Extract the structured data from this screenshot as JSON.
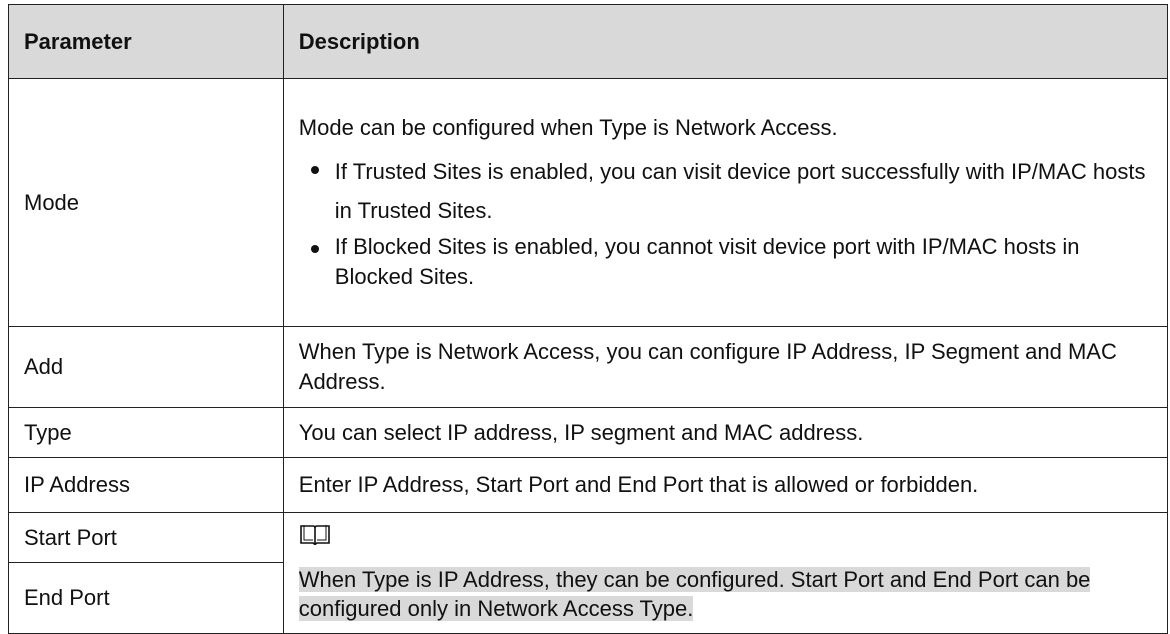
{
  "table": {
    "headers": {
      "parameter": "Parameter",
      "description": "Description"
    },
    "mode": {
      "name": "Mode",
      "intro": "Mode can be configured when Type is Network Access.",
      "bullets": [
        "If Trusted Sites is enabled, you can visit device port successfully with IP/MAC hosts in Trusted Sites.",
        "If Blocked Sites is enabled, you cannot visit device port with IP/MAC hosts in Blocked Sites."
      ]
    },
    "add": {
      "name": "Add",
      "description": "When Type is Network Access, you can configure IP Address, IP Segment and MAC Address."
    },
    "type": {
      "name": "Type",
      "description": "You can select IP address, IP segment and MAC address."
    },
    "ip_address": {
      "name": "IP Address",
      "description": "Enter IP Address, Start Port and End Port that is allowed or forbidden."
    },
    "start_port": {
      "name": "Start Port"
    },
    "end_port": {
      "name": "End Port"
    },
    "note": {
      "icon": "book-note-icon",
      "text": "When Type is IP Address, they can be configured. Start Port and End Port can be configured only in Network Access Type."
    }
  }
}
